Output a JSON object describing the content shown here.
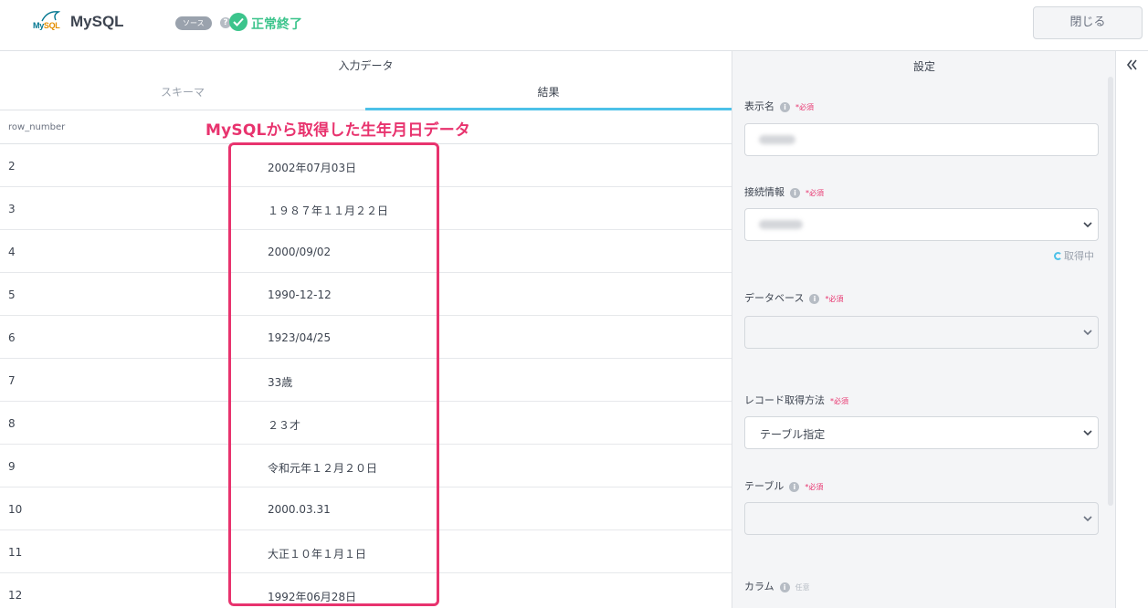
{
  "header": {
    "logo_text_my": "My",
    "logo_text_sql": "SQL",
    "title": "MySQL",
    "source_badge": "ソース",
    "help_glyph": "?",
    "status": "正常終了",
    "close_label": "閉じる",
    "colors": {
      "status": "#3cc48c",
      "accent": "#4dc1e8",
      "annotation": "#e8336e"
    }
  },
  "input_data": {
    "title": "入力データ",
    "tabs": [
      {
        "label": "スキーマ",
        "active": false
      },
      {
        "label": "結果",
        "active": true
      }
    ],
    "column_header": "row_number",
    "annotation": "MySQLから取得した生年月日データ",
    "rows": [
      {
        "row_number": "2",
        "value": "2002年07月03日"
      },
      {
        "row_number": "3",
        "value": "１９８７年１１月２２日"
      },
      {
        "row_number": "4",
        "value": "2000/09/02"
      },
      {
        "row_number": "5",
        "value": "1990-12-12"
      },
      {
        "row_number": "6",
        "value": "1923/04/25"
      },
      {
        "row_number": "7",
        "value": "33歳"
      },
      {
        "row_number": "8",
        "value": "２３才"
      },
      {
        "row_number": "9",
        "value": "令和元年１２月２０日"
      },
      {
        "row_number": "10",
        "value": "2000.03.31"
      },
      {
        "row_number": "11",
        "value": "大正１０年１月１日"
      },
      {
        "row_number": "12",
        "value": "1992年06月28日"
      }
    ]
  },
  "settings": {
    "title": "設定",
    "info_glyph": "i",
    "required_label": "*必須",
    "optional_label": "任意",
    "display_name": {
      "label": "表示名"
    },
    "connection": {
      "label": "接続情報",
      "loading": "取得中"
    },
    "database": {
      "label": "データベース"
    },
    "record_method": {
      "label": "レコード取得方法",
      "value": "テーブル指定"
    },
    "table": {
      "label": "テーブル"
    },
    "column": {
      "label": "カラム"
    }
  },
  "collapse": {
    "icon": "double-chevron-left-icon"
  }
}
